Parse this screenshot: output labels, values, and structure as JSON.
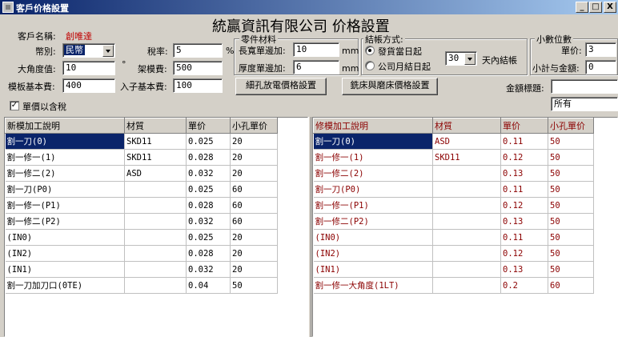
{
  "window": {
    "title": "客戶价格設置",
    "min": "_",
    "max": "□",
    "close": "X"
  },
  "heading": "統贏資訊有限公司  价格設置",
  "customer": {
    "label": "客戶名稱:",
    "value": "創唯達"
  },
  "currency": {
    "label": "幣別:",
    "value": "民幣"
  },
  "tax": {
    "label": "稅率:",
    "value": "5",
    "unit": "%"
  },
  "angle": {
    "label": "大角度值:",
    "value": "10",
    "unit": "°"
  },
  "rack_fee": {
    "label": "架模費:",
    "value": "500"
  },
  "template_fee": {
    "label": "模板基本費:",
    "value": "400"
  },
  "insert_fee": {
    "label": "入子基本費:",
    "value": "100"
  },
  "tax_included": {
    "label": "單價以含稅",
    "checked": true
  },
  "parts": {
    "title": "零件材料",
    "width_label": "長寬單邊加:",
    "width_value": "10",
    "width_unit": "mm",
    "thick_label": "厚度單邊加:",
    "thick_value": "6",
    "thick_unit": "mm"
  },
  "billing": {
    "title": "結帳方式:",
    "option1": "發貨當日起",
    "option2": "公司月結日起",
    "days_value": "30",
    "days_label": "天內結帳",
    "selected": "option1"
  },
  "decimals": {
    "title": "小數位數",
    "price_label": "單价:",
    "price_value": "3",
    "subtotal_label": "小計与金額:",
    "subtotal_value": "0"
  },
  "buttons": {
    "edm": "細孔放電價格設置",
    "mill": "銑床與磨床價格設置"
  },
  "amount_title": {
    "label": "金額標題:",
    "value": "",
    "filter": "所有"
  },
  "new_grid": {
    "headers": [
      "新模加工說明",
      "材質",
      "單价",
      "小孔單价"
    ],
    "rows": [
      [
        "割一刀(0)",
        "SKD11",
        "0.025",
        "20"
      ],
      [
        "割一修一(1)",
        "SKD11",
        "0.028",
        "20"
      ],
      [
        "割一修二(2)",
        "ASD",
        "0.032",
        "20"
      ],
      [
        "割一刀(P0)",
        "",
        "0.025",
        "60"
      ],
      [
        "割一修一(P1)",
        "",
        "0.028",
        "60"
      ],
      [
        "割一修二(P2)",
        "",
        "0.032",
        "60"
      ],
      [
        "(IN0)",
        "",
        "0.025",
        "20"
      ],
      [
        "(IN2)",
        "",
        "0.028",
        "20"
      ],
      [
        "(IN1)",
        "",
        "0.032",
        "20"
      ],
      [
        "割一刀加刀口(0TE)",
        "",
        "0.04",
        "50"
      ]
    ]
  },
  "repair_grid": {
    "headers": [
      "修模加工說明",
      "材質",
      "單价",
      "小孔單价"
    ],
    "rows": [
      [
        "割一刀(0)",
        "ASD",
        "0.11",
        "50"
      ],
      [
        "割一修一(1)",
        "SKD11",
        "0.12",
        "50"
      ],
      [
        "割一修二(2)",
        "",
        "0.13",
        "50"
      ],
      [
        "割一刀(P0)",
        "",
        "0.11",
        "50"
      ],
      [
        "割一修一(P1)",
        "",
        "0.12",
        "50"
      ],
      [
        "割一修二(P2)",
        "",
        "0.13",
        "50"
      ],
      [
        "(IN0)",
        "",
        "0.11",
        "50"
      ],
      [
        "(IN2)",
        "",
        "0.12",
        "50"
      ],
      [
        "(IN1)",
        "",
        "0.13",
        "50"
      ],
      [
        "割一修一大角度(1LT)",
        "",
        "0.2",
        "60"
      ]
    ]
  },
  "colors": {
    "titlebar": "#0a246a",
    "selection": "#0a246a",
    "repair_text": "#8b0000",
    "customer_value": "#c00000"
  }
}
